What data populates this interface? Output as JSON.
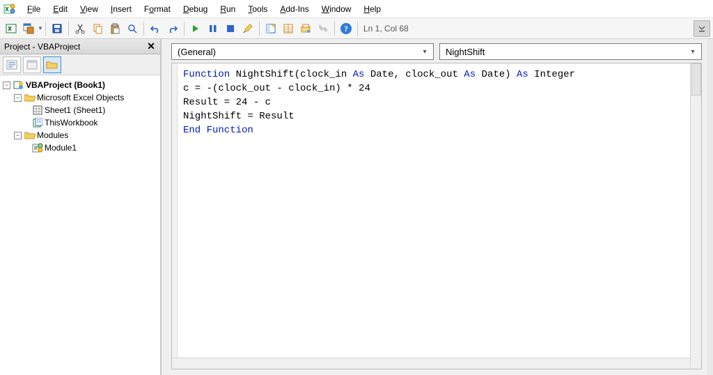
{
  "menu": {
    "items": [
      {
        "label": "File",
        "u": "F"
      },
      {
        "label": "Edit",
        "u": "E"
      },
      {
        "label": "View",
        "u": "V"
      },
      {
        "label": "Insert",
        "u": "I"
      },
      {
        "label": "Format",
        "u": "o"
      },
      {
        "label": "Debug",
        "u": "D"
      },
      {
        "label": "Run",
        "u": "R"
      },
      {
        "label": "Tools",
        "u": "T"
      },
      {
        "label": "Add-Ins",
        "u": "A"
      },
      {
        "label": "Window",
        "u": "W"
      },
      {
        "label": "Help",
        "u": "H"
      }
    ]
  },
  "toolbar": {
    "status": "Ln 1, Col 68"
  },
  "project_pane": {
    "title": "Project - VBAProject",
    "root": "VBAProject (Book1)",
    "excel_objects_label": "Microsoft Excel Objects",
    "sheet_label": "Sheet1 (Sheet1)",
    "workbook_label": "ThisWorkbook",
    "modules_label": "Modules",
    "module1_label": "Module1"
  },
  "combos": {
    "left": "(General)",
    "right": "NightShift"
  },
  "code": {
    "lines": [
      {
        "type": "mixed",
        "parts": [
          {
            "t": "Function",
            "kw": true
          },
          {
            "t": " NightShift(clock_in "
          },
          {
            "t": "As",
            "kw": true
          },
          {
            "t": " Date, clock_out "
          },
          {
            "t": "As",
            "kw": true
          },
          {
            "t": " Date) "
          },
          {
            "t": "As",
            "kw": true
          },
          {
            "t": " Integer"
          }
        ]
      },
      {
        "type": "plain",
        "text": "c = -(clock_out - clock_in) * 24"
      },
      {
        "type": "plain",
        "text": "Result = 24 - c"
      },
      {
        "type": "plain",
        "text": "NightShift = Result"
      },
      {
        "type": "mixed",
        "parts": [
          {
            "t": "End Function",
            "kw": true
          }
        ]
      }
    ]
  },
  "colors": {
    "keyword": "#0018bf",
    "accent": "#3a8ed8"
  }
}
